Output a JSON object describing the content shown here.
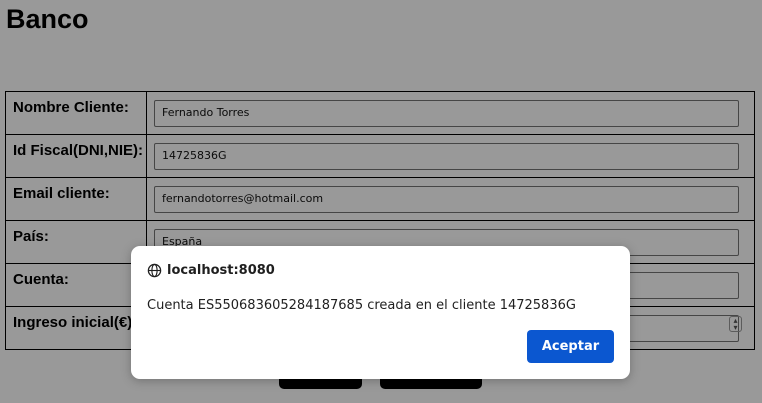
{
  "page": {
    "title": "Banco"
  },
  "form": {
    "rows": [
      {
        "label": "Nombre Cliente:",
        "value": "Fernando Torres"
      },
      {
        "label": "Id Fiscal(DNI,NIE):",
        "value": "14725836G"
      },
      {
        "label": "Email cliente:",
        "value": "fernandotorres@hotmail.com"
      },
      {
        "label": "País:",
        "value": "España"
      },
      {
        "label": "Cuenta:",
        "value": ""
      },
      {
        "label": "Ingreso inicial(€):",
        "value": ""
      }
    ]
  },
  "dialog": {
    "origin": "localhost:8080",
    "message": "Cuenta ES550683605284187685 creada en el cliente 14725836G",
    "accept_label": "Aceptar",
    "icon": "globe-icon",
    "accent_color": "#0b57d0"
  }
}
